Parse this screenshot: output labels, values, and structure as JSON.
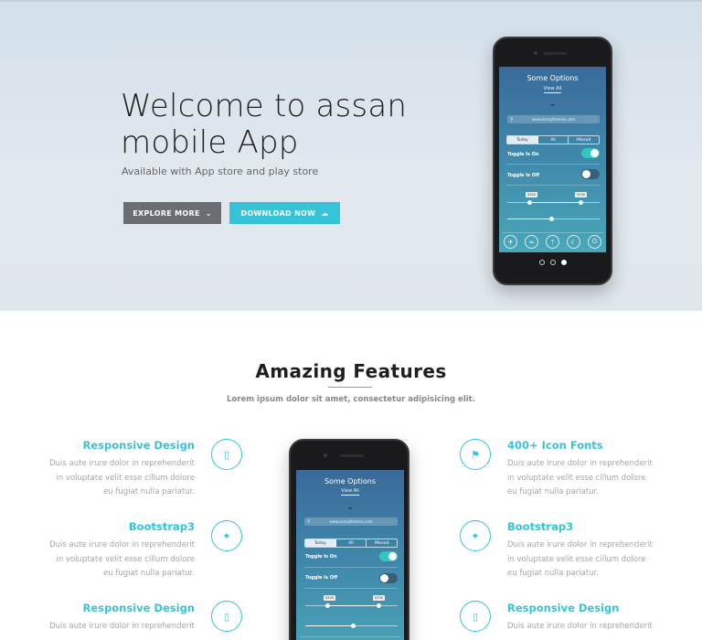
{
  "hero": {
    "title": "Welcome to assan mobile App",
    "subtitle": "Available with App store and play store",
    "explore_label": "EXPLORE MORE",
    "download_label": "DOWNLOAD NOW"
  },
  "phone_screen": {
    "title": "Some Options",
    "view_all": "View All",
    "search_placeholder": "www.ococpthemes.com",
    "segments": [
      "Today",
      "All",
      "Missed"
    ],
    "active_segment": "Today",
    "toggle_on_label": "Toggle Is On",
    "toggle_off_label": "Toggle Is Off",
    "slider_min_tag": "$100",
    "slider_max_tag": "$700",
    "icons": [
      "airplane-icon",
      "wifi-icon",
      "bluetooth-icon",
      "moon-icon",
      "power-icon"
    ]
  },
  "carousel": {
    "count": 3,
    "active_index": 2
  },
  "features": {
    "title": "Amazing Features",
    "subtitle": "Lorem ipsum dolor sit amet, consectetur adipisicing elit.",
    "items": [
      {
        "title": "Responsive Design",
        "text": "Duis aute irure dolor in reprehenderit in voluptate velit esse cillum dolore eu fugiat nulla pariatur.",
        "icon": "mobile-icon"
      },
      {
        "title": "Bootstrap3",
        "text": "Duis aute irure dolor in reprehenderit in voluptate velit esse cillum dolore eu fugiat nulla pariatur.",
        "icon": "twitter-icon"
      },
      {
        "title": "Responsive Design",
        "text": "Duis aute irure dolor in reprehenderit",
        "icon": "mobile-icon"
      },
      {
        "title": "400+ Icon Fonts",
        "text": "Duis aute irure dolor in reprehenderit in voluptate velit esse cillum dolore eu fugiat nulla pariatur.",
        "icon": "flag-icon"
      },
      {
        "title": "Bootstrap3",
        "text": "Duis aute irure dolor in reprehenderit in voluptate velit esse cillum dolore eu fugiat nulla pariatur.",
        "icon": "twitter-icon"
      },
      {
        "title": "Responsive Design",
        "text": "Duis aute irure dolor in reprehenderit",
        "icon": "mobile-icon"
      }
    ]
  },
  "colors": {
    "accent": "#35c3d7",
    "button_dark": "#6a6d72"
  }
}
